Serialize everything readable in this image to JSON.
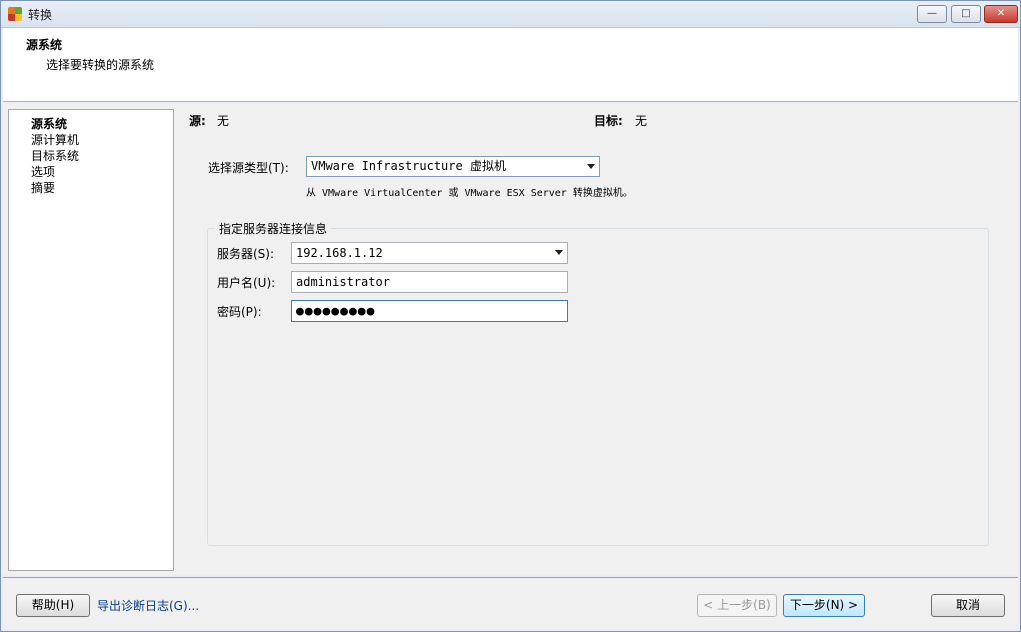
{
  "window": {
    "title": "转换",
    "minimize_glyph": "—",
    "maximize_glyph": "□",
    "close_glyph": "✕",
    "icon_colors": [
      "#e07a23",
      "#5ea82e",
      "#c23a2d",
      "#f2c12e"
    ]
  },
  "header": {
    "title": "源系统",
    "subtitle": "选择要转换的源系统"
  },
  "nav": {
    "items": [
      {
        "label": "源系统",
        "active": true
      },
      {
        "label": "源计算机",
        "active": false
      },
      {
        "label": "目标系统",
        "active": false
      },
      {
        "label": "选项",
        "active": false
      },
      {
        "label": "摘要",
        "active": false
      }
    ]
  },
  "summary": {
    "source_label": "源:",
    "source_value": "无",
    "target_label": "目标:",
    "target_value": "无"
  },
  "source_type": {
    "label": "选择源类型(T):",
    "value": "VMware Infrastructure 虚拟机",
    "hint": "从 VMware VirtualCenter 或 VMware ESX Server 转换虚拟机。"
  },
  "server_group": {
    "legend": "指定服务器连接信息",
    "server_label": "服务器(S):",
    "server_value": "192.168.1.12",
    "username_label": "用户名(U):",
    "username_value": "administrator",
    "password_label": "密码(P):",
    "password_value": "●●●●●●●●●"
  },
  "footer": {
    "help_label": "帮助(H)",
    "export_log_label": "导出诊断日志(G)...",
    "back_label": "< 上一步(B)",
    "next_label": "下一步(N) >",
    "cancel_label": "取消"
  }
}
